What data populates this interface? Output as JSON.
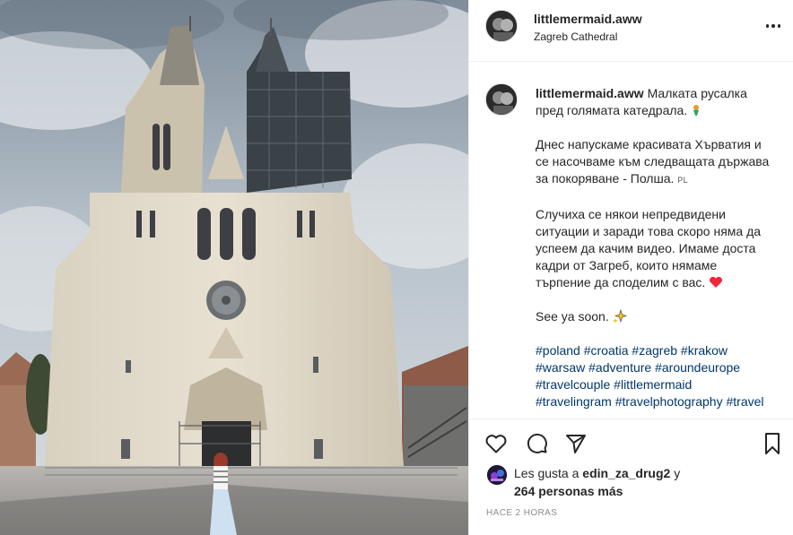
{
  "post": {
    "username": "littlemermaid.aww",
    "location": "Zagreb Cathedral",
    "more_icon": "more-horizontal-icon",
    "caption": {
      "username": "littlemermaid.aww",
      "line1": "Малката русалка пред голямата катедрала.",
      "para2": "Днес напускаме красивата Хърватия и се насочваме към следващата държава за покоряване - Полша.",
      "para2_flag": "PL",
      "para3": "Случиха се някои непредвидени ситуации и заради това скоро няма да успеем да качим видео. Имаме доста кадри от Загреб, които нямаме търпение да споделим с вас.",
      "para4": "See ya soon.",
      "hashtags": [
        "#poland",
        "#croatia",
        "#zagreb",
        "#krakow",
        "#warsaw",
        "#adventure",
        "#aroundeurope",
        "#travelcouple",
        "#littlemermaid",
        "#travelingram",
        "#travelphotography",
        "#travel"
      ]
    },
    "actions": {
      "like_icon": "heart-outline-icon",
      "comment_icon": "comment-bubble-icon",
      "share_icon": "send-paper-plane-icon",
      "save_icon": "bookmark-icon"
    },
    "likes": {
      "prefix": "Les gusta a",
      "first_user": "edin_za_drug2",
      "conjunction": "y",
      "others": "264 personas más"
    },
    "timestamp": "Hace 2 horas"
  },
  "colors": {
    "text": "#262626",
    "hashtag": "#00376b",
    "muted": "#8e8e8e",
    "divider": "#efefef",
    "heart_red": "#ed2939"
  }
}
